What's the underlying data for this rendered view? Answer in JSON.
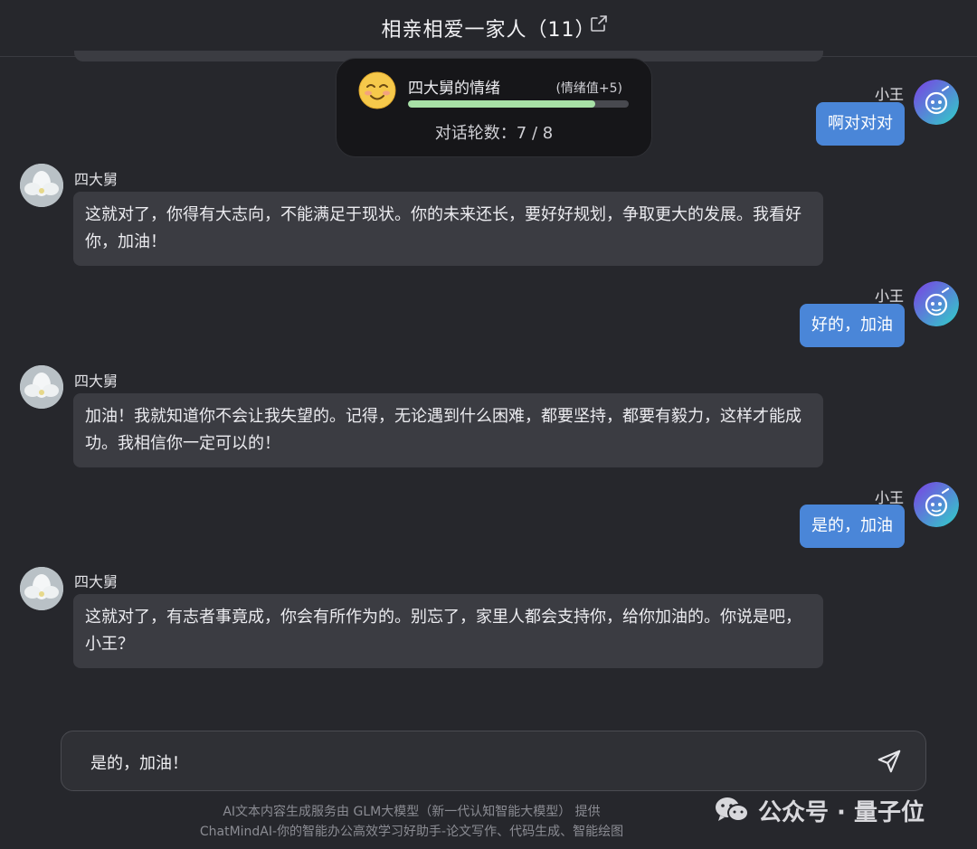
{
  "header": {
    "title": "相亲相爱一家人（11）"
  },
  "emotion": {
    "title": "四大舅的情绪",
    "delta": "(情绪值+5)",
    "progress": 0.85,
    "turns_label": "对话轮数：7 / 8"
  },
  "messages": [
    {
      "side": "right",
      "name": "小王",
      "text": "啊对对对"
    },
    {
      "side": "left",
      "name": "四大舅",
      "text": "这就对了，你得有大志向，不能满足于现状。你的未来还长，要好好规划，争取更大的发展。我看好你，加油！"
    },
    {
      "side": "right",
      "name": "小王",
      "text": "好的，加油"
    },
    {
      "side": "left",
      "name": "四大舅",
      "text": "加油！我就知道你不会让我失望的。记得，无论遇到什么困难，都要坚持，都要有毅力，这样才能成功。我相信你一定可以的！"
    },
    {
      "side": "right",
      "name": "小王",
      "text": "是的，加油"
    },
    {
      "side": "left",
      "name": "四大舅",
      "text": "这就对了，有志者事竟成，你会有所作为的。别忘了，家里人都会支持你，给你加油的。你说是吧，小王？"
    }
  ],
  "input": {
    "value": "是的，加油！"
  },
  "footer": {
    "line1": "AI文本内容生成服务由 GLM大模型（新一代认知智能大模型） 提供",
    "line2": "ChatMindAI-你的智能办公高效学习好助手-论文写作、代码生成、智能绘图"
  },
  "watermark": {
    "text": "公众号 · 量子位"
  },
  "colors": {
    "background": "#26272c",
    "bubble_left": "#3b3c42",
    "bubble_right": "#4a86d8",
    "progress": "#a7e0a6"
  }
}
